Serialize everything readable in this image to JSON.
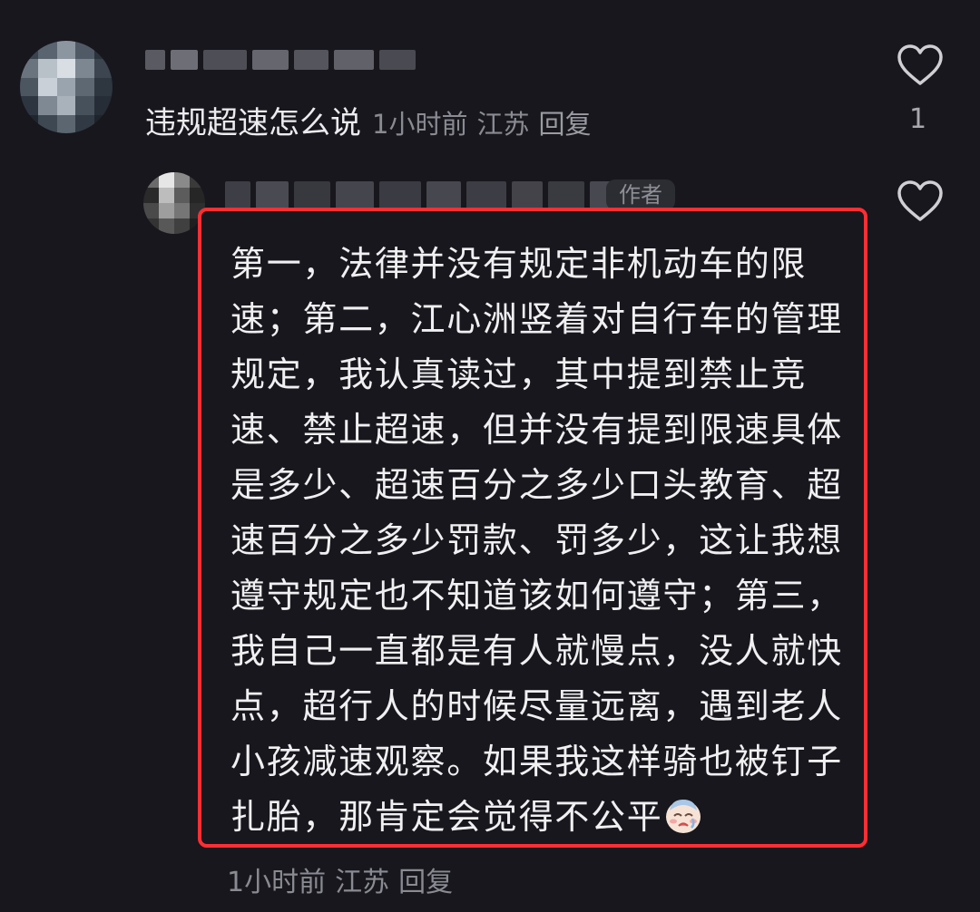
{
  "comment": {
    "text": "违规超速怎么说",
    "time": "1小时前",
    "location": "江苏",
    "reply_label": "回复",
    "like_count": "1"
  },
  "reply": {
    "author_tag": "作者",
    "text": "第一，法律并没有规定非机动车的限速；第二，江心洲竖着对自行车的管理规定，我认真读过，其中提到禁止竞速、禁止超速，但并没有提到限速具体是多少、超速百分之多少口头教育、超速百分之多少罚款、罚多少，这让我想遵守规定也不知道该如何遵守；第三，我自己一直都是有人就慢点，没人就快点，超行人的时候尽量远离，遇到老人小孩减速观察。如果我这样骑也被钉子扎胎，那肯定会觉得不公平",
    "emoji": "crying-face-emoji",
    "time": "1小时前",
    "location": "江苏",
    "reply_label": "回复"
  },
  "colors": {
    "background": "#17171d",
    "highlight_border": "#ff2e33",
    "meta_text": "#8a8a93"
  }
}
